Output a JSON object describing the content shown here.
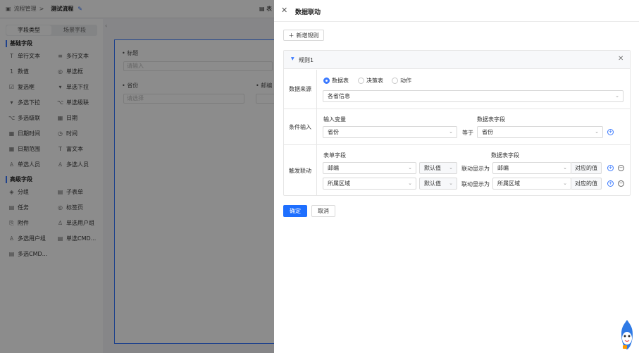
{
  "background": {
    "breadcrumb_root": "流程管理",
    "breadcrumb_sep": ">",
    "current": "测试流程",
    "right_tab": "表",
    "left_tabs": [
      "字段类型",
      "场景字段"
    ],
    "basic_group": "基础字段",
    "basic_fields": [
      {
        "icon": "T",
        "label": "单行文本"
      },
      {
        "icon": "≡",
        "label": "多行文本"
      },
      {
        "icon": "1",
        "label": "数值"
      },
      {
        "icon": "◎",
        "label": "单选框"
      },
      {
        "icon": "☑",
        "label": "复选框"
      },
      {
        "icon": "▾",
        "label": "单选下拉"
      },
      {
        "icon": "▾",
        "label": "多选下拉"
      },
      {
        "icon": "⌥",
        "label": "单选级联"
      },
      {
        "icon": "⌥",
        "label": "多选级联"
      },
      {
        "icon": "▦",
        "label": "日期"
      },
      {
        "icon": "▦",
        "label": "日期时间"
      },
      {
        "icon": "◷",
        "label": "时间"
      },
      {
        "icon": "▦",
        "label": "日期范围"
      },
      {
        "icon": "T",
        "label": "富文本"
      },
      {
        "icon": "♙",
        "label": "单选人员"
      },
      {
        "icon": "♙",
        "label": "多选人员"
      }
    ],
    "advanced_group": "高级字段",
    "advanced_fields": [
      {
        "icon": "◈",
        "label": "分组"
      },
      {
        "icon": "▤",
        "label": "子表单"
      },
      {
        "icon": "▤",
        "label": "任务"
      },
      {
        "icon": "◎",
        "label": "标签页"
      },
      {
        "icon": "⎘",
        "label": "附件"
      },
      {
        "icon": "♙",
        "label": "单选用户组"
      },
      {
        "icon": "♙",
        "label": "多选用户组"
      },
      {
        "icon": "▤",
        "label": "单选CMD..."
      },
      {
        "icon": "▤",
        "label": "多选CMD..."
      }
    ],
    "form": {
      "title_label": "标题",
      "title_placeholder": "请输入",
      "province_label": "省份",
      "province_placeholder": "请选择",
      "code_label": "邮编"
    }
  },
  "drawer": {
    "title": "数据联动",
    "add_rule": "新增规则",
    "rule_name": "规则1",
    "source": {
      "label": "数据来源",
      "options": [
        "数据表",
        "决策表",
        "动作"
      ],
      "selected_index": 0,
      "table_value": "各省信息"
    },
    "condition": {
      "label": "条件输入",
      "input_var_label": "输入变量",
      "table_field_label": "数据表字段",
      "input_var_value": "省份",
      "operator": "等于",
      "table_field_value": "省份"
    },
    "trigger": {
      "label": "触发联动",
      "form_field_label": "表单字段",
      "table_field_label": "数据表字段",
      "rows": [
        {
          "form_field": "邮编",
          "default": "默认值",
          "display_as": "联动显示为",
          "table_field": "邮编",
          "suffix": "对应的值"
        },
        {
          "form_field": "所属区域",
          "default": "默认值",
          "display_as": "联动显示为",
          "table_field": "所属区域",
          "suffix": "对应的值"
        }
      ]
    },
    "ok": "确定",
    "cancel": "取消"
  },
  "colors": {
    "primary": "#1e6fff",
    "overlay": "rgba(0,0,0,0.45)"
  }
}
